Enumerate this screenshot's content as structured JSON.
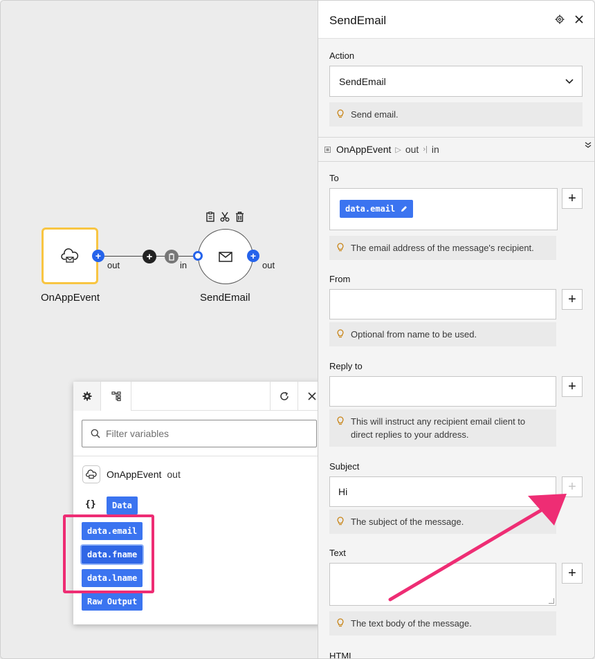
{
  "flow": {
    "source_node": {
      "label": "OnAppEvent",
      "out_port": "out"
    },
    "target_node": {
      "label": "SendEmail",
      "in_port": "in",
      "out_port": "out"
    }
  },
  "variables_popup": {
    "filter_placeholder": "Filter variables",
    "source": {
      "name": "OnAppEvent",
      "port": "out"
    },
    "braces": "{}",
    "chips": [
      "Data",
      "data.email",
      "data.fname",
      "data.lname",
      "Raw Output"
    ]
  },
  "panel": {
    "title": "SendEmail",
    "action": {
      "label": "Action",
      "value": "SendEmail",
      "hint": "Send email."
    },
    "breadcrumb": {
      "node": "OnAppEvent",
      "out": "out",
      "in": "in"
    },
    "fields": {
      "to": {
        "label": "To",
        "chip": "data.email",
        "hint": "The email address of the message's recipient."
      },
      "from": {
        "label": "From",
        "value": "",
        "hint": "Optional from name to be used."
      },
      "reply_to": {
        "label": "Reply to",
        "value": "",
        "hint": "This will instruct any recipient email client to direct replies to your address."
      },
      "subject": {
        "label": "Subject",
        "value": "Hi",
        "hint": "The subject of the message."
      },
      "text": {
        "label": "Text",
        "value": "",
        "hint": "The text body of the message."
      },
      "html": {
        "label": "HTML"
      }
    }
  },
  "colors": {
    "accent": "#3b74f0",
    "node_border": "#f8c542",
    "annotation": "#ee2d74"
  }
}
